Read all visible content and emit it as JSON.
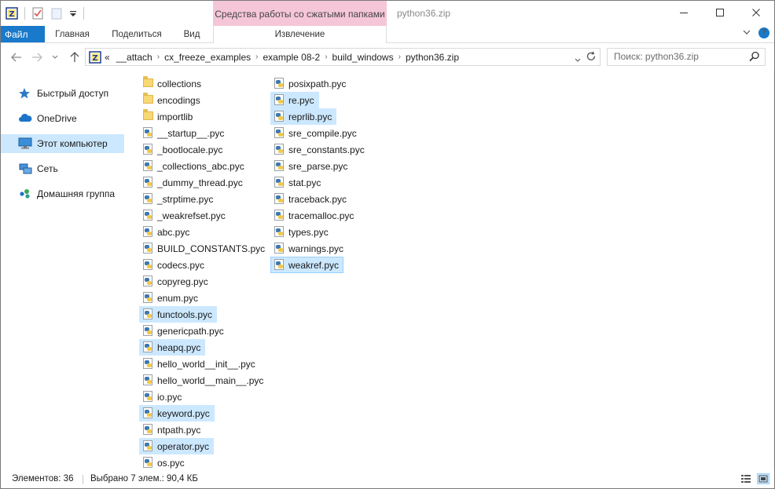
{
  "window": {
    "title": "python36.zip",
    "context_group": "Средства работы со сжатыми папками",
    "context_tab": "Извлечение"
  },
  "ribbon": {
    "tabs": [
      {
        "label": "Файл"
      },
      {
        "label": "Главная"
      },
      {
        "label": "Поделиться"
      },
      {
        "label": "Вид"
      }
    ]
  },
  "address": {
    "overflow": "«",
    "crumbs": [
      "__attach",
      "cx_freeze_examples",
      "example 08-2",
      "build_windows",
      "python36.zip"
    ],
    "search_placeholder": "Поиск: python36.zip"
  },
  "nav": {
    "items": [
      {
        "label": "Быстрый доступ",
        "icon": "star-icon"
      },
      {
        "label": "OneDrive",
        "icon": "cloud-icon"
      },
      {
        "label": "Этот компьютер",
        "icon": "computer-icon"
      },
      {
        "label": "Сеть",
        "icon": "network-icon"
      },
      {
        "label": "Домашняя группа",
        "icon": "homegroup-icon"
      }
    ]
  },
  "files": {
    "col1": [
      {
        "name": "collections",
        "type": "folder"
      },
      {
        "name": "encodings",
        "type": "folder"
      },
      {
        "name": "importlib",
        "type": "folder"
      },
      {
        "name": "__startup__.pyc",
        "type": "pyc"
      },
      {
        "name": "_bootlocale.pyc",
        "type": "pyc"
      },
      {
        "name": "_collections_abc.pyc",
        "type": "pyc"
      },
      {
        "name": "_dummy_thread.pyc",
        "type": "pyc"
      },
      {
        "name": "_strptime.pyc",
        "type": "pyc"
      },
      {
        "name": "_weakrefset.pyc",
        "type": "pyc"
      },
      {
        "name": "abc.pyc",
        "type": "pyc"
      },
      {
        "name": "BUILD_CONSTANTS.pyc",
        "type": "pyc"
      },
      {
        "name": "codecs.pyc",
        "type": "pyc"
      },
      {
        "name": "copyreg.pyc",
        "type": "pyc"
      },
      {
        "name": "enum.pyc",
        "type": "pyc"
      },
      {
        "name": "functools.pyc",
        "type": "pyc",
        "selected": true
      },
      {
        "name": "genericpath.pyc",
        "type": "pyc"
      },
      {
        "name": "heapq.pyc",
        "type": "pyc",
        "selected": true
      },
      {
        "name": "hello_world__init__.pyc",
        "type": "pyc"
      },
      {
        "name": "hello_world__main__.pyc",
        "type": "pyc"
      },
      {
        "name": "io.pyc",
        "type": "pyc"
      },
      {
        "name": "keyword.pyc",
        "type": "pyc",
        "selected": true
      },
      {
        "name": "ntpath.pyc",
        "type": "pyc"
      },
      {
        "name": "operator.pyc",
        "type": "pyc",
        "selected": true
      },
      {
        "name": "os.pyc",
        "type": "pyc"
      }
    ],
    "col2": [
      {
        "name": "posixpath.pyc",
        "type": "pyc"
      },
      {
        "name": "re.pyc",
        "type": "pyc",
        "selected": true
      },
      {
        "name": "reprlib.pyc",
        "type": "pyc",
        "selected": true
      },
      {
        "name": "sre_compile.pyc",
        "type": "pyc"
      },
      {
        "name": "sre_constants.pyc",
        "type": "pyc"
      },
      {
        "name": "sre_parse.pyc",
        "type": "pyc"
      },
      {
        "name": "stat.pyc",
        "type": "pyc"
      },
      {
        "name": "traceback.pyc",
        "type": "pyc"
      },
      {
        "name": "tracemalloc.pyc",
        "type": "pyc"
      },
      {
        "name": "types.pyc",
        "type": "pyc"
      },
      {
        "name": "warnings.pyc",
        "type": "pyc"
      },
      {
        "name": "weakref.pyc",
        "type": "pyc",
        "selected": true,
        "focused": true
      }
    ]
  },
  "status": {
    "count": "Элементов: 36",
    "selection": "Выбрано 7 элем.: 90,4 КБ"
  },
  "colors": {
    "accent": "#1979ca",
    "selection": "#cce8ff",
    "context_tab": "#f5c6d8"
  }
}
